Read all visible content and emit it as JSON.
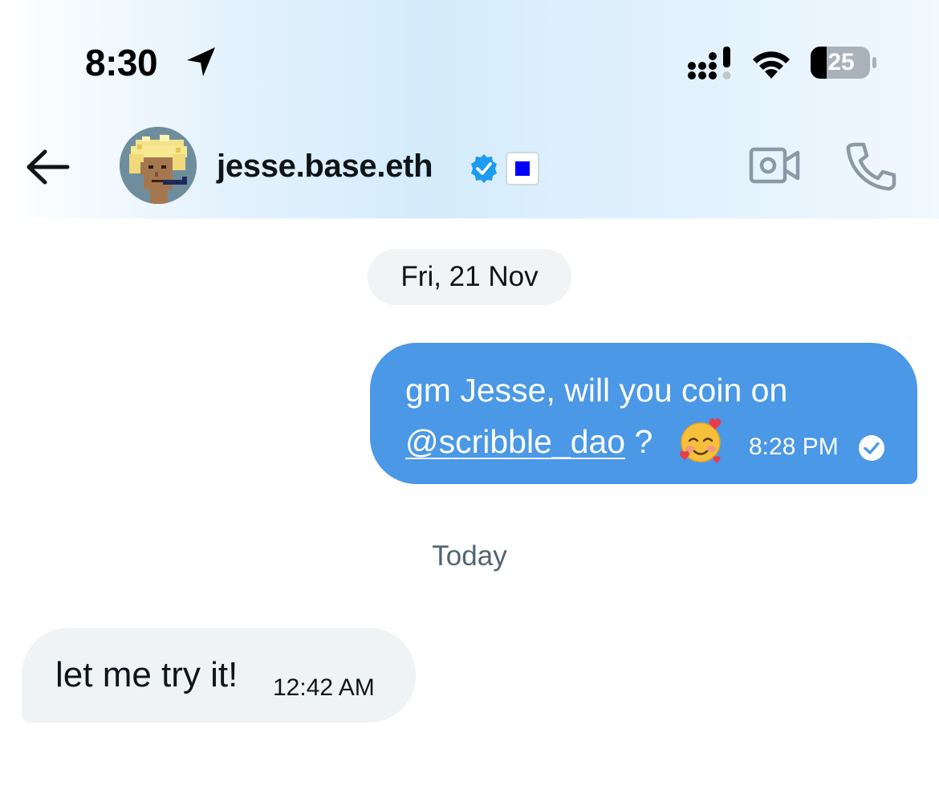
{
  "status_bar": {
    "time": "8:30",
    "battery_level": "25",
    "icons": [
      "location-arrow-icon",
      "cellular-signal-icon",
      "wifi-icon",
      "battery-icon"
    ]
  },
  "header": {
    "contact_name": "jesse.base.eth",
    "icons": [
      "back-arrow-icon",
      "verified-badge-icon",
      "blue-square-badge-icon",
      "video-call-icon",
      "phone-call-icon"
    ]
  },
  "conversation": {
    "date_separator": "Fri, 21 Nov",
    "outgoing_message": {
      "text_line1": "gm Jesse, will you coin on",
      "mention": "@scribble_dao",
      "after_mention": " ?",
      "emoji": "🥰",
      "time": "8:28 PM",
      "status_icon": "read-check-icon"
    },
    "day_separator": "Today",
    "incoming_message": {
      "text": "let me try it!",
      "time": "12:42 AM"
    }
  },
  "colors": {
    "outgoing_bubble": "#4a98e6",
    "incoming_bubble": "#eff3f4",
    "verified_blue": "#1d9bf0",
    "badge_square": "#0000ff",
    "header_gradient": "#d4ecfb"
  }
}
